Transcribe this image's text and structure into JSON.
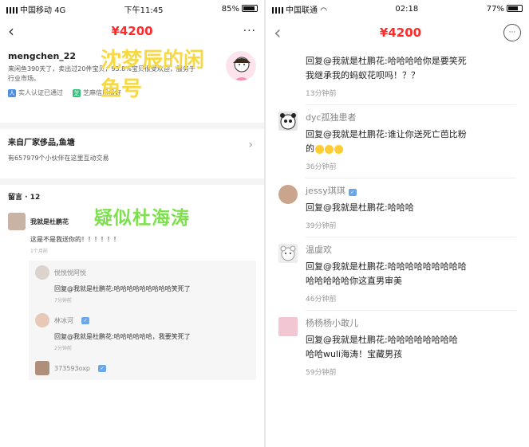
{
  "left": {
    "status": {
      "carrier": "中国移动",
      "network": "4G",
      "time": "下午11:45",
      "battery": "85%",
      "battery_level": 0.85
    },
    "nav": {
      "back_icon": "‹",
      "price": "¥4200",
      "more_icon": "···"
    },
    "seller": {
      "name": "mengchen_22",
      "desc_line1": "来闲鱼390天了，卖出过20件宝贝，93.8%宝贝很受欢迎，服务于",
      "desc_line2": "行业市场。",
      "badge_realname": "实人认证已通过",
      "badge_second": "芝麻信用极好"
    },
    "overlay_yellow_1": "沈梦辰的闲",
    "overlay_yellow_2": "鱼号",
    "pond": {
      "title": "来自厂家侈品,鱼塘",
      "count": "有657979个小伙伴在这里互动交易"
    },
    "comments_title": "留言 · 12",
    "overlay_green": "疑似杜海涛",
    "comment": {
      "name": "我就是杜鹏花",
      "text": "这是不是我送你的！！！！！！",
      "time": "1个月前"
    },
    "replies": [
      {
        "name": "悦悦悦阿悦",
        "text": "回复@我就是杜鹏花:哈哈哈哈哈哈哈哈哈笑死了",
        "time": "7分钟前"
      },
      {
        "name": "林冰河",
        "text": "回复@我就是杜鹏花:哈哈哈哈哈哈，我要笑死了",
        "time": "2分钟前"
      }
    ],
    "last_commenter": "373593oxp"
  },
  "right": {
    "status": {
      "carrier": "中国联通",
      "time": "02:18",
      "battery": "77%",
      "battery_level": 0.77
    },
    "nav": {
      "back_icon": "‹",
      "price": "¥4200",
      "more_icon": "···"
    },
    "items": [
      {
        "name": "",
        "line1": "回复@我就是杜鹏花:哈哈哈哈你是要笑死",
        "line2": "我继承我的蚂蚁花呗吗！？？",
        "time": "13分钟前"
      },
      {
        "name": "dyc孤独患者",
        "line1": "回复@我就是杜鹏花:谁让你送死亡芭比粉",
        "line2": "的",
        "time": "36分钟前"
      },
      {
        "name": "jessy琪琪",
        "line1": "回复@我就是杜鹏花:哈哈哈",
        "line2": "",
        "time": "39分钟前"
      },
      {
        "name": "温虞欢",
        "line1": "回复@我就是杜鹏花:哈哈哈哈哈哈哈哈哈",
        "line2": "哈哈哈哈哈你这直男审美",
        "time": "46分钟前"
      },
      {
        "name": "杨杨杨小敢儿",
        "line1": "回复@我就是杜鹏花:哈哈哈哈哈哈哈哈",
        "line2": "哈哈wuli海涛！宝藏男孩",
        "time": "59分钟前"
      }
    ]
  }
}
